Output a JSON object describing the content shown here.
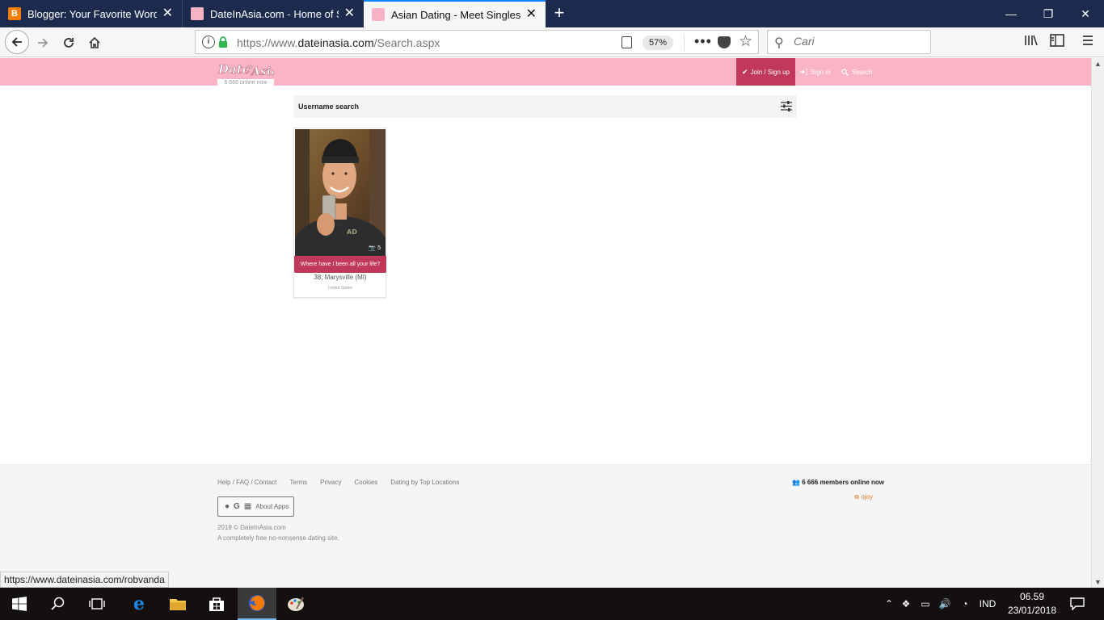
{
  "browser": {
    "tabs": [
      {
        "title": "Blogger: Your Favorite Word - E",
        "favicon": "blogger-icon"
      },
      {
        "title": "DateInAsia.com - Home of Sing",
        "favicon": "dateinasia-icon"
      },
      {
        "title": "Asian Dating - Meet Singles at D",
        "favicon": "dateinasia-icon",
        "active": true
      }
    ],
    "url_prefix": "https://www.",
    "url_domain": "dateinasia.com",
    "url_path": "/Search.aspx",
    "zoom": "57%",
    "search_placeholder": "Cari",
    "status_url": "https://www.dateinasia.com/robvanda"
  },
  "site": {
    "logo_text": "Date in Asia",
    "online_now": "6 666 online now",
    "nav": {
      "join": "Join / Sign up",
      "signin": "Sign in",
      "search": "Search"
    },
    "search_label": "Username search",
    "result": {
      "photo_count": "5",
      "tagline": "Where have I been all your life?",
      "location": "38, Marysville (MI)",
      "country": "United States"
    },
    "footer": {
      "links": [
        "Help / FAQ / Contact",
        "Terms",
        "Privacy",
        "Cookies",
        "Dating by Top Locations"
      ],
      "members": "6 666 members online now",
      "ojoy": "ojoy",
      "apps": "About Apps",
      "copyright": "2018 © DateInAsia.com",
      "tagline": "A completely free no-nonsense dating site."
    }
  },
  "taskbar": {
    "language": "IND",
    "time": "06.59",
    "date": "23/01/2018"
  },
  "colors": {
    "header_pink": "#fbb3c6",
    "accent": "#c0395a",
    "tabstrip": "#1c2a4d"
  }
}
